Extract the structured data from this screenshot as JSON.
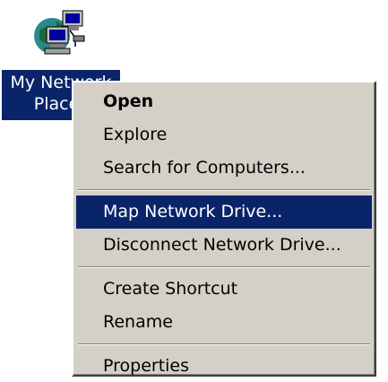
{
  "desktop_icon": {
    "label": "My Network Places",
    "icon": "network-computers-icon"
  },
  "context_menu": {
    "groups": [
      [
        {
          "label": "Open",
          "default": true
        },
        {
          "label": "Explore"
        },
        {
          "label": "Search for Computers..."
        }
      ],
      [
        {
          "label": "Map Network Drive...",
          "highlighted": true
        },
        {
          "label": "Disconnect Network Drive..."
        }
      ],
      [
        {
          "label": "Create Shortcut"
        },
        {
          "label": "Rename"
        }
      ],
      [
        {
          "label": "Properties"
        }
      ]
    ]
  },
  "colors": {
    "selection_bg": "#0a246a",
    "selection_fg": "#ffffff",
    "menu_bg": "#d4d0c8",
    "desktop_bg": "#ffffff"
  }
}
